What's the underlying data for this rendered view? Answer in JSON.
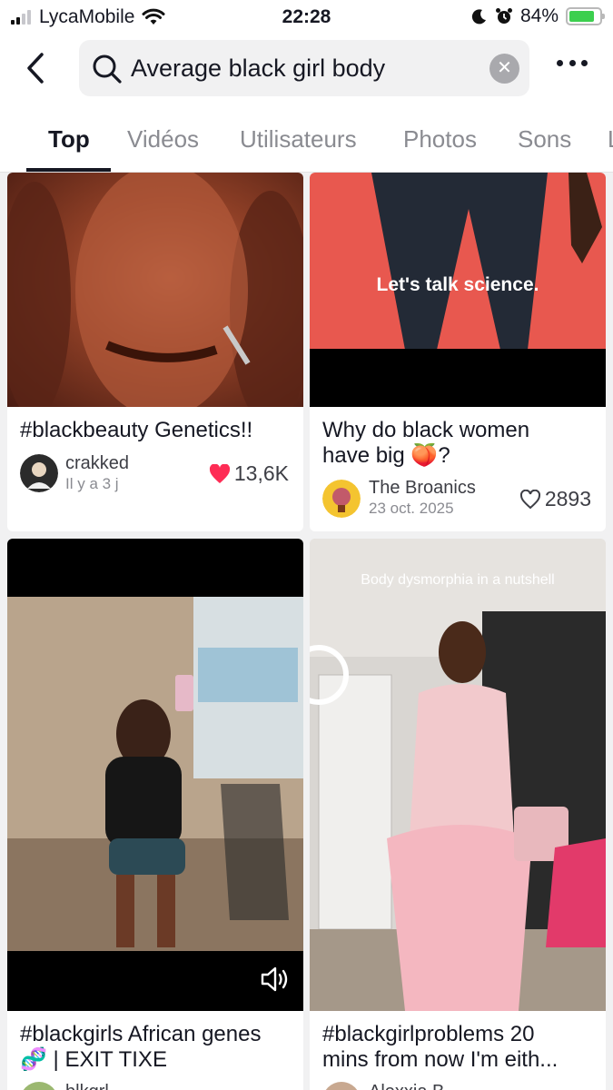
{
  "status_bar": {
    "carrier": "LycaMobile",
    "time": "22:28",
    "battery": "84%",
    "battery_level": 0.84
  },
  "search": {
    "query": "Average black girl body",
    "icon": "search-icon",
    "clear_icon": "clear-icon",
    "back_icon": "back-arrow-icon",
    "more_icon": "more-options-icon"
  },
  "tabs": [
    {
      "label": "Top",
      "active": true
    },
    {
      "label": "Vidéos",
      "active": false
    },
    {
      "label": "Utilisateurs",
      "active": false
    },
    {
      "label": "Photos",
      "active": false
    },
    {
      "label": "Sons",
      "active": false
    }
  ],
  "results": [
    {
      "title": "#blackbeauty Genetics!!",
      "author": "crakked",
      "date": "Il y a 3 j",
      "likes": "13,6K",
      "liked": true
    },
    {
      "title_line1": "Why do black women",
      "title_line2": "have big",
      "title_emoji": "🍑",
      "title_end": "?",
      "overlay": "Let's talk science.",
      "author": "The Broanics",
      "date": "23 oct. 2025",
      "likes": "2893",
      "liked": false
    },
    {
      "title_line1": "#blackgirls African genes",
      "title_emoji": "🧬",
      "title_line2": " | EXIT TIXE",
      "author": "blkgrl",
      "sound_icon": "sound-icon"
    },
    {
      "overlay": "Body dysmorphia in a nutshell",
      "title_line1": "#blackgirlproblems 20",
      "title_line2": "mins from now I'm eith...",
      "author": "Alexxia B"
    }
  ],
  "colors": {
    "accent": "#161823",
    "like_red": "#fe2c55",
    "battery_green": "#3ccf4e",
    "background": "#f1f1f2"
  }
}
